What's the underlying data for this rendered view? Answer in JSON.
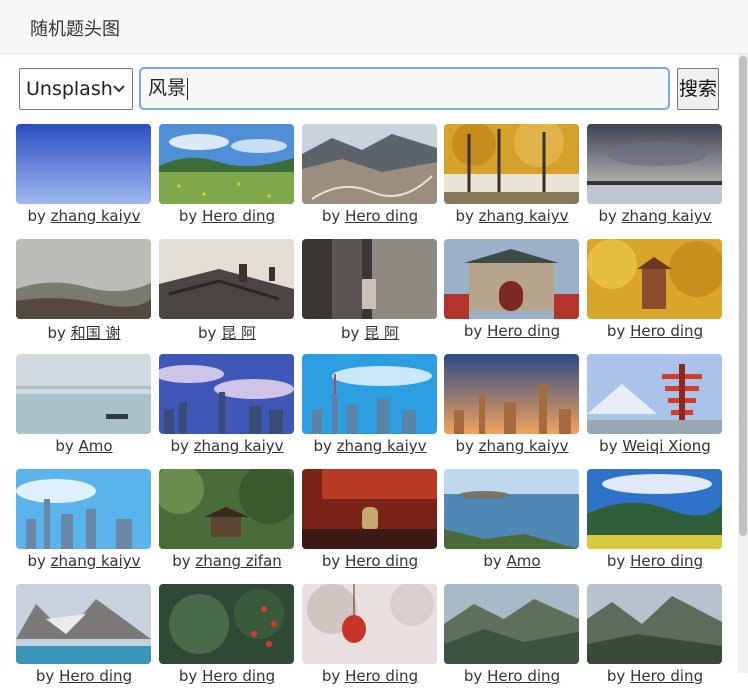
{
  "window": {
    "title": "随机题头图"
  },
  "search": {
    "source_selected": "Unsplash",
    "query": "风景",
    "button_label": "搜索"
  },
  "by_label": "by",
  "photos": [
    {
      "author": "zhang kaiyv",
      "scene": "blue-sky"
    },
    {
      "author": "Hero ding",
      "scene": "green-meadow"
    },
    {
      "author": "Hero ding",
      "scene": "mountain-road"
    },
    {
      "author": "zhang kaiyv",
      "scene": "autumn-trees"
    },
    {
      "author": "zhang kaiyv",
      "scene": "cloudy-lake"
    },
    {
      "author": "和国 谢",
      "scene": "hazy-hills"
    },
    {
      "author": "昆 阿",
      "scene": "old-rooftops"
    },
    {
      "author": "昆 阿",
      "scene": "alley-sepia"
    },
    {
      "author": "Hero ding",
      "scene": "red-temple-gate"
    },
    {
      "author": "Hero ding",
      "scene": "ginkgo-pagoda"
    },
    {
      "author": "Amo",
      "scene": "misty-sea-boat"
    },
    {
      "author": "zhang kaiyv",
      "scene": "city-clouds"
    },
    {
      "author": "zhang kaiyv",
      "scene": "city-skyline-blue"
    },
    {
      "author": "zhang kaiyv",
      "scene": "city-skyline-sunset"
    },
    {
      "author": "Weiqi Xiong",
      "scene": "pagoda-fuji"
    },
    {
      "author": "zhang kaiyv",
      "scene": "city-skyline-day"
    },
    {
      "author": "zhang zifan",
      "scene": "forest-pavilion"
    },
    {
      "author": "Hero ding",
      "scene": "temple-bell"
    },
    {
      "author": "Amo",
      "scene": "island-coast"
    },
    {
      "author": "Hero ding",
      "scene": "green-hills-sky"
    },
    {
      "author": "Hero ding",
      "scene": "glacier-lake"
    },
    {
      "author": "Hero ding",
      "scene": "leaves-flowers"
    },
    {
      "author": "Hero ding",
      "scene": "red-lantern"
    },
    {
      "author": "Hero ding",
      "scene": "mountain-range"
    },
    {
      "author": "Hero ding",
      "scene": "rocky-peaks"
    }
  ]
}
